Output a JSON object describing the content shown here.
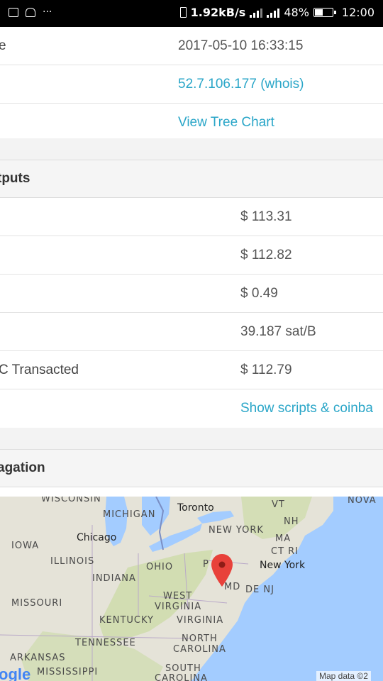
{
  "statusbar": {
    "network_speed": "1.92kB/s",
    "battery_percent": "48%",
    "time": "12:00",
    "icons": [
      "image-icon",
      "reader-icon",
      "more-icon",
      "vibrate-icon",
      "signal-icon",
      "battery-icon"
    ],
    "battery_level": 0.48
  },
  "details": {
    "rows": [
      {
        "label": "e",
        "value": "2017-05-10 16:33:15",
        "link": false
      },
      {
        "label": "",
        "value": "52.7.106.177 (whois)",
        "link": true
      },
      {
        "label": "",
        "value": "View Tree Chart",
        "link": true
      }
    ]
  },
  "outputs": {
    "heading": "tputs",
    "rows": [
      {
        "label": "",
        "value": "$ 113.31",
        "link": false
      },
      {
        "label": "",
        "value": "$ 112.82",
        "link": false
      },
      {
        "label": "",
        "value": "$ 0.49",
        "link": false
      },
      {
        "label": "",
        "value": "39.187 sat/B",
        "link": false
      },
      {
        "label": "C Transacted",
        "value": "$ 112.79",
        "link": false
      },
      {
        "label": "",
        "value": "Show scripts & coinba",
        "link": true
      }
    ]
  },
  "propagation": {
    "heading": "agation"
  },
  "map": {
    "labels": {
      "wisconsin": "WISCONSIN",
      "michigan": "MICHIGAN",
      "toronto": "Toronto",
      "vt": "VT",
      "nova": "NOVA",
      "nh": "NH",
      "iowa": "IOWA",
      "chicago": "Chicago",
      "new_york_state": "NEW YORK",
      "ma": "MA",
      "ct_ri": "CT RI",
      "illinois": "ILLINOIS",
      "ohio": "OHIO",
      "pa": "P",
      "new_york_city": "New York",
      "indiana": "INDIANA",
      "md": "MD",
      "de_nj": "DE NJ",
      "west_virginia_1": "WEST",
      "west_virginia_2": "VIRGINIA",
      "missouri": "MISSOURI",
      "kentucky": "KENTUCKY",
      "virginia": "VIRGINIA",
      "tennessee": "TENNESSEE",
      "north_carolina_1": "NORTH",
      "north_carolina_2": "CAROLINA",
      "arkansas": "ARKANSAS",
      "google": "ogle",
      "mississippi": "MISSISSIPPI",
      "south_carolina_1": "SOUTH",
      "south_carolina_2": "CAROLINA",
      "attribution": "Map data ©2"
    },
    "colors": {
      "water": "#a3ccff",
      "land": "#e5e3d8",
      "green": "#cfdcae",
      "marker": "#e8413a"
    }
  }
}
